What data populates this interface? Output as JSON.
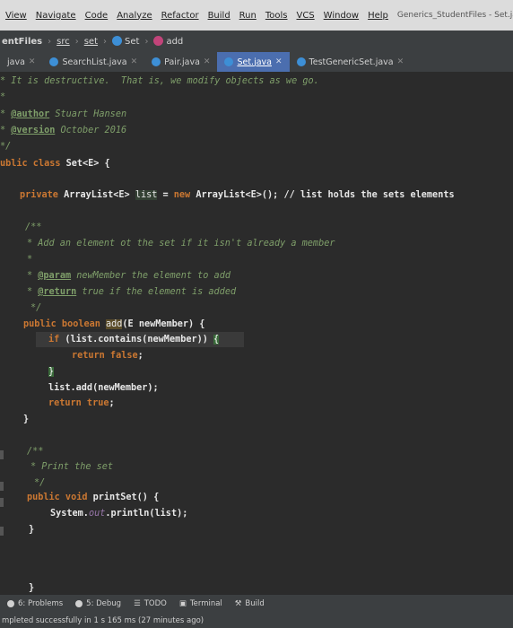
{
  "menu": {
    "items": [
      "View",
      "Navigate",
      "Code",
      "Analyze",
      "Refactor",
      "Build",
      "Run",
      "Tools",
      "VCS",
      "Window",
      "Help"
    ],
    "window_title": "Generics_StudentFiles - Set.ja"
  },
  "breadcrumb": {
    "project": "entFiles",
    "src": "src",
    "pkg": "set",
    "cls": "Set",
    "method": "add"
  },
  "tabs": [
    {
      "label": "java",
      "active": false
    },
    {
      "label": "SearchList.java",
      "active": false
    },
    {
      "label": "Pair.java",
      "active": false
    },
    {
      "label": "Set.java",
      "active": true
    },
    {
      "label": "TestGenericSet.java",
      "active": false
    }
  ],
  "code": {
    "l1": "* It is destructive.  That is, we modify objects as we go.",
    "l2": "*",
    "l3_tag": "@author",
    "l3_rest": " Stuart Hansen",
    "l4_tag": "@version",
    "l4_rest": " October 2016",
    "l5": "*/",
    "l6_kw": "ublic class ",
    "l6_rest": "Set<E> {",
    "l7_kw": "private ",
    "l7_type": "ArrayList<E> ",
    "l7_field": "list",
    "l7_mid": " = ",
    "l7_new": "new ",
    "l7_type2": "ArrayList<E>(); ",
    "l7_cm": "// list holds the sets elements",
    "l8": "/**",
    "l9": "* Add an element ot the set if it isn't already a member",
    "l10": "*",
    "l11_tag": "@param",
    "l11_rest": " newMember the element to add",
    "l12_tag": "@return",
    "l12_rest": " true if the element is added",
    "l13": "*/",
    "l14_kw": "public boolean ",
    "l14_name": "add",
    "l14_rest": "(E newMember) {",
    "l15_kw": "if ",
    "l15_rest": "(list.contains(newMember)) ",
    "l15_brace": "{",
    "l16_kw": "return false",
    "l16_rest": ";",
    "l17_brace": "}",
    "l18": "list.add(newMember);",
    "l19_kw": "return true",
    "l19_rest": ";",
    "l20": "}",
    "l21": "/**",
    "l22": "* Print the set",
    "l23": "*/",
    "l24_kw": "public void ",
    "l24_rest": "printSet() {",
    "l25_a": "System.",
    "l25_b": "out",
    "l25_c": ".println(list);",
    "l26": "}",
    "l27": "}"
  },
  "toolwindows": [
    "6: Problems",
    "5: Debug",
    "TODO",
    "Terminal",
    "Build"
  ],
  "status": "mpleted successfully in 1 s 165 ms (27 minutes ago)"
}
